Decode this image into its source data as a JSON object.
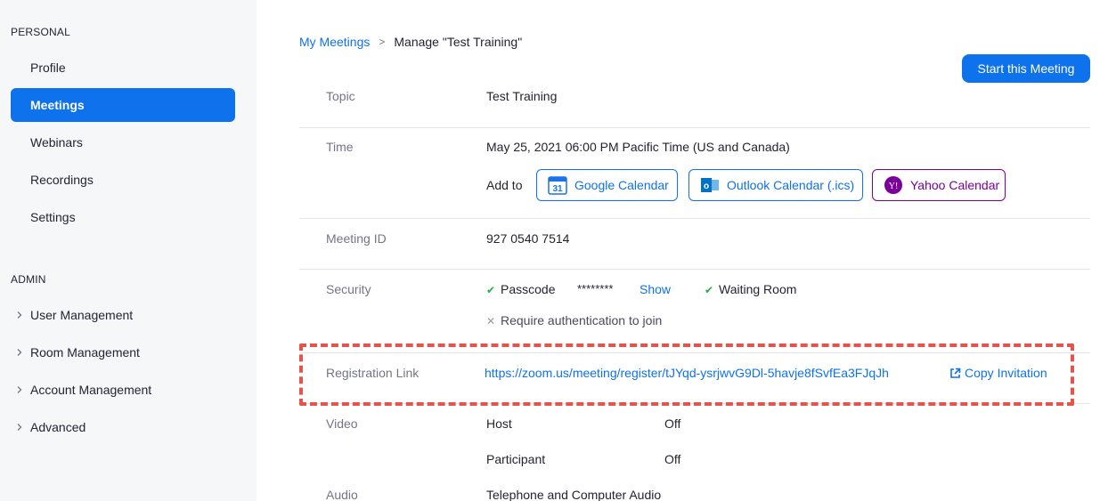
{
  "sidebar": {
    "personal_label": "PERSONAL",
    "personal_items": [
      "Profile",
      "Meetings",
      "Webinars",
      "Recordings",
      "Settings"
    ],
    "active_item": "Meetings",
    "admin_label": "ADMIN",
    "admin_items": [
      "User Management",
      "Room Management",
      "Account Management",
      "Advanced"
    ]
  },
  "breadcrumb": {
    "parent": "My Meetings",
    "separator": ">",
    "current": "Manage \"Test Training\""
  },
  "start_button": "Start this Meeting",
  "topic": {
    "label": "Topic",
    "value": "Test Training"
  },
  "time": {
    "label": "Time",
    "value": "May 25, 2021 06:00 PM Pacific Time (US and Canada)",
    "add_to": "Add to",
    "google": "Google Calendar",
    "google_icon_text": "31",
    "outlook": "Outlook Calendar (.ics)",
    "outlook_icon_text": "o",
    "yahoo": "Yahoo Calendar",
    "yahoo_icon_text": "Y!"
  },
  "meeting_id": {
    "label": "Meeting ID",
    "value": "927 0540 7514"
  },
  "security": {
    "label": "Security",
    "passcode": "Passcode",
    "passcode_mask": "********",
    "show": "Show",
    "waiting_room": "Waiting Room",
    "require_auth": "Require authentication to join"
  },
  "registration": {
    "label": "Registration Link",
    "url": "https://zoom.us/meeting/register/tJYqd-ysrjwvG9Dl-5havje8fSvfEa3FJqJh",
    "copy": "Copy Invitation"
  },
  "video": {
    "label": "Video",
    "host": "Host",
    "host_value": "Off",
    "participant": "Participant",
    "participant_value": "Off"
  },
  "audio": {
    "label": "Audio",
    "value": "Telephone and Computer Audio"
  },
  "colors": {
    "accent": "#0e72ed",
    "yahoo": "#7b0099",
    "check": "#2da84e",
    "highlight": "#e5534b"
  }
}
